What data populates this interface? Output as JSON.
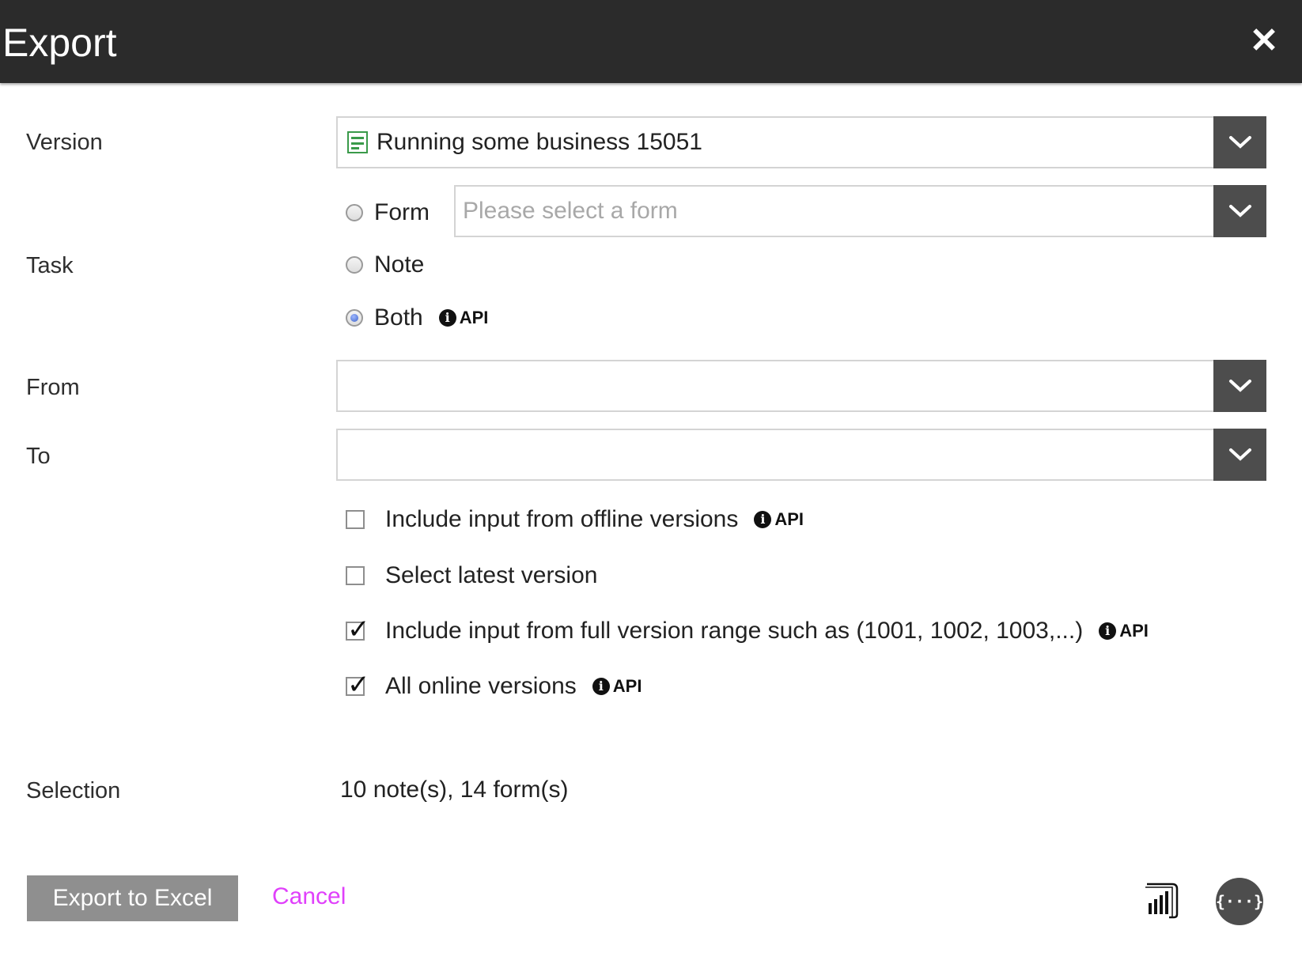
{
  "dialog": {
    "title": "Export",
    "close_glyph": "✕"
  },
  "version": {
    "label": "Version",
    "selected": "Running some business 15051",
    "icon": "form-document-icon"
  },
  "task": {
    "label": "Task",
    "form_label": "Form",
    "form_placeholder": "Please select a form",
    "note_label": "Note",
    "both_label": "Both",
    "selected": "Both",
    "api_label": "API"
  },
  "from": {
    "label": "From",
    "value": ""
  },
  "to": {
    "label": "To",
    "value": ""
  },
  "options": {
    "offline": {
      "label": "Include input from offline versions",
      "checked": false,
      "api_label": "API"
    },
    "latest": {
      "label": "Select latest version",
      "checked": false
    },
    "full_range": {
      "label": "Include input from full version range such as (1001, 1002, 1003,...)",
      "checked": true,
      "api_label": "API"
    },
    "all_online": {
      "label": "All online versions",
      "checked": true,
      "api_label": "API"
    }
  },
  "selection": {
    "label": "Selection",
    "value": "10 note(s), 14 form(s)"
  },
  "actions": {
    "export_label": "Export to Excel",
    "cancel_label": "Cancel",
    "powerbi_icon": "power-bi-icon",
    "json_icon": "json-braces-icon",
    "json_glyph": "{···}"
  },
  "colors": {
    "accent_link": "#e040fb",
    "header_bg": "#2b2b2b",
    "button_bg": "#8f8f8f"
  }
}
